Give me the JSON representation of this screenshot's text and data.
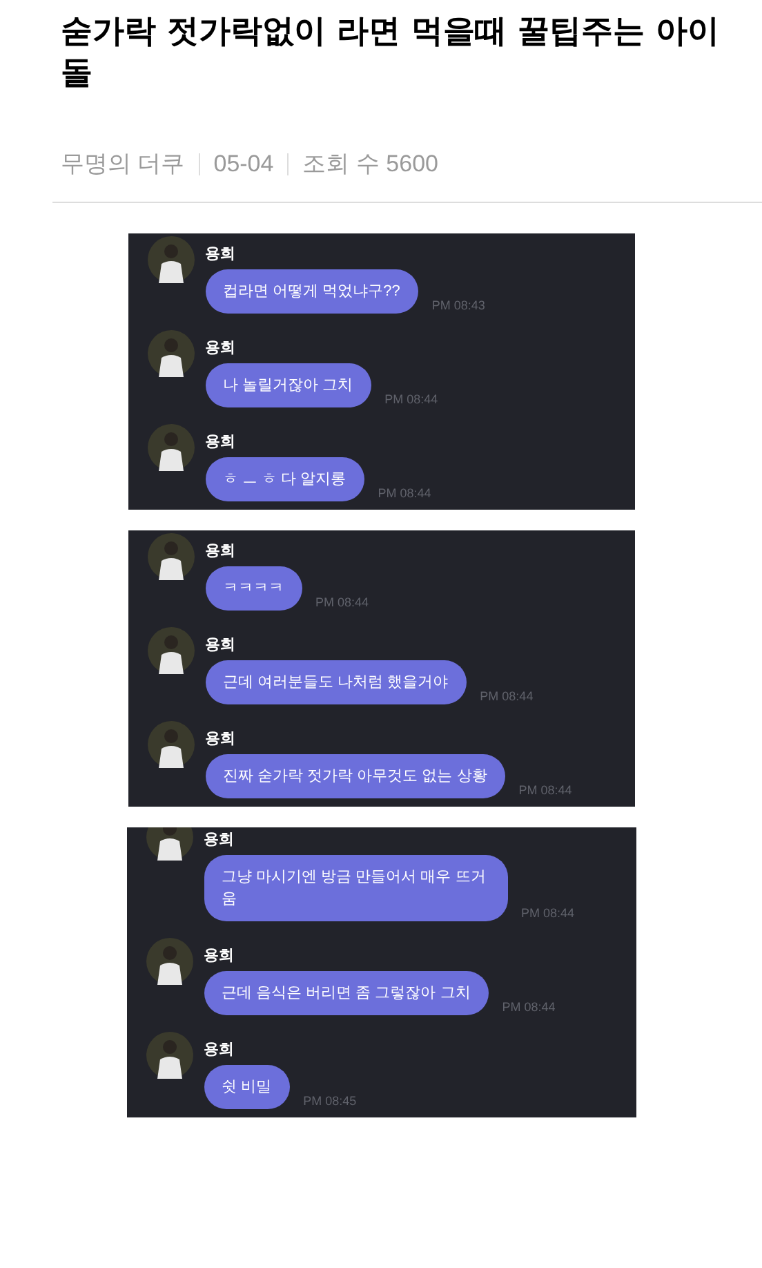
{
  "post": {
    "title": "숟가락 젓가락없이 라면 먹을때 꿀팁주는 아이돌",
    "author": "무명의 더쿠",
    "date": "05-04",
    "views": "조회 수 5600"
  },
  "screenshots": [
    {
      "cut_top": false,
      "messages": [
        {
          "sender": "용희",
          "text": "컵라면 어떻게 먹었냐구??",
          "time": "PM 08:43"
        },
        {
          "sender": "용희",
          "text": "나 놀릴거잖아 그치",
          "time": "PM 08:44"
        },
        {
          "sender": "용희",
          "text": "ㅎ ㅡ ㅎ 다 알지롱",
          "time": "PM 08:44"
        }
      ]
    },
    {
      "cut_top": false,
      "messages": [
        {
          "sender": "용희",
          "text": "ㅋㅋㅋㅋ",
          "time": "PM 08:44"
        },
        {
          "sender": "용희",
          "text": "근데 여러분들도 나처럼 했을거야",
          "time": "PM 08:44"
        },
        {
          "sender": "용희",
          "text": "진짜 숟가락 젓가락 아무것도 없는 상황",
          "time": "PM 08:44"
        }
      ]
    },
    {
      "cut_top": true,
      "messages": [
        {
          "sender": "용희",
          "text": "그냥 마시기엔 방금 만들어서 매우 뜨거움",
          "time": "PM 08:44"
        },
        {
          "sender": "용희",
          "text": "근데 음식은 버리면 좀 그렇잖아 그치",
          "time": "PM 08:44"
        },
        {
          "sender": "용희",
          "text": "쉿 비밀",
          "time": "PM 08:45"
        }
      ]
    }
  ]
}
